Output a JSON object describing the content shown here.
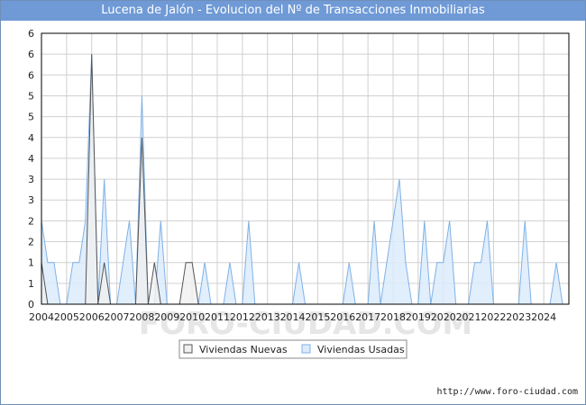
{
  "header": {
    "title": "Lucena de Jalón - Evolucion del Nº de Transacciones Inmobiliarias"
  },
  "footer": {
    "source": "http://www.foro-ciudad.com"
  },
  "watermark": "FORO-CIUDAD.COM",
  "colors": {
    "title_bg": "#6f9ad6",
    "nuevas_fill": "#f0f0f0",
    "nuevas_line": "#555555",
    "usadas_fill": "#dcebfb",
    "usadas_line": "#7fb2e6",
    "grid": "#d0d0d0"
  },
  "chart_data": {
    "type": "area",
    "title": "Lucena de Jalón - Evolucion del Nº de Transacciones Inmobiliarias",
    "xlabel": "",
    "ylabel": "",
    "ylim": [
      0,
      6.5
    ],
    "x_ticks": [
      "2004",
      "2005",
      "2006",
      "2007",
      "2008",
      "2009",
      "2010",
      "2011",
      "2012",
      "2013",
      "2014",
      "2015",
      "2016",
      "2017",
      "2018",
      "2019",
      "2020",
      "2021",
      "2022",
      "2023",
      "2024"
    ],
    "y_ticks": [
      {
        "value": 0,
        "label": "0"
      },
      {
        "value": 0.5,
        "label": "1"
      },
      {
        "value": 1,
        "label": "1"
      },
      {
        "value": 1.5,
        "label": "2"
      },
      {
        "value": 2,
        "label": "2"
      },
      {
        "value": 2.5,
        "label": "3"
      },
      {
        "value": 3,
        "label": "3"
      },
      {
        "value": 3.5,
        "label": "4"
      },
      {
        "value": 4,
        "label": "4"
      },
      {
        "value": 4.5,
        "label": "5"
      },
      {
        "value": 5,
        "label": "5"
      },
      {
        "value": 5.5,
        "label": "6"
      },
      {
        "value": 6,
        "label": "6"
      },
      {
        "value": 6.5,
        "label": "6"
      }
    ],
    "grid": true,
    "legend": "bottom-center",
    "series": [
      {
        "name": "Viviendas Nuevas",
        "x": [
          2004.0,
          2004.25,
          2004.5,
          2004.75,
          2005.0,
          2005.25,
          2005.5,
          2005.75,
          2006.0,
          2006.25,
          2006.5,
          2006.75,
          2007.0,
          2007.25,
          2007.5,
          2007.75,
          2008.0,
          2008.25,
          2008.5,
          2008.75,
          2009.0,
          2009.25,
          2009.5,
          2009.75,
          2010.0,
          2010.25,
          2010.5,
          2010.75,
          2011.0,
          2011.25,
          2024.75
        ],
        "y": [
          1,
          0,
          0,
          0,
          0,
          0,
          0,
          0,
          6,
          0,
          1,
          0,
          0,
          0,
          0,
          0,
          4,
          0,
          1,
          0,
          0,
          0,
          0,
          1,
          1,
          0,
          0,
          0,
          0,
          0,
          0
        ]
      },
      {
        "name": "Viviendas Usadas",
        "x": [
          2004.0,
          2004.25,
          2004.5,
          2004.75,
          2005.0,
          2005.25,
          2005.5,
          2005.75,
          2006.0,
          2006.25,
          2006.5,
          2006.75,
          2007.0,
          2007.25,
          2007.5,
          2007.75,
          2008.0,
          2008.25,
          2008.5,
          2008.75,
          2009.0,
          2009.25,
          2009.5,
          2009.75,
          2010.0,
          2010.25,
          2010.5,
          2010.75,
          2011.0,
          2011.25,
          2011.5,
          2011.75,
          2012.0,
          2012.25,
          2012.5,
          2012.75,
          2013.0,
          2013.25,
          2013.5,
          2013.75,
          2014.0,
          2014.25,
          2014.5,
          2014.75,
          2015.0,
          2015.25,
          2015.5,
          2015.75,
          2016.0,
          2016.25,
          2016.5,
          2016.75,
          2017.0,
          2017.25,
          2017.5,
          2017.75,
          2018.0,
          2018.25,
          2018.5,
          2018.75,
          2019.0,
          2019.25,
          2019.5,
          2019.75,
          2020.0,
          2020.25,
          2020.5,
          2020.75,
          2021.0,
          2021.25,
          2021.5,
          2021.75,
          2022.0,
          2022.25,
          2022.5,
          2022.75,
          2023.0,
          2023.25,
          2023.5,
          2023.75,
          2024.0,
          2024.25,
          2024.5,
          2024.75
        ],
        "y": [
          2,
          1,
          1,
          0,
          0,
          1,
          1,
          2,
          6,
          0,
          3,
          0,
          0,
          1,
          2,
          0,
          5,
          0,
          0,
          2,
          0,
          0,
          0,
          0,
          0,
          0,
          1,
          0,
          0,
          0,
          1,
          0,
          0,
          2,
          0,
          0,
          0,
          0,
          0,
          0,
          0,
          1,
          0,
          0,
          0,
          0,
          0,
          0,
          0,
          1,
          0,
          0,
          0,
          2,
          0,
          1,
          2,
          3,
          1,
          0,
          0,
          2,
          0,
          1,
          1,
          2,
          0,
          0,
          0,
          1,
          1,
          2,
          0,
          0,
          0,
          0,
          0,
          2,
          0,
          0,
          0,
          0,
          1,
          0
        ]
      }
    ]
  }
}
